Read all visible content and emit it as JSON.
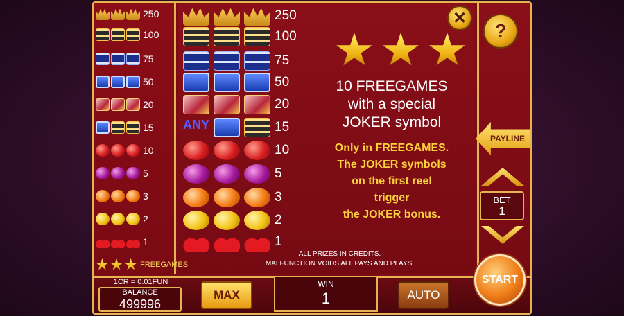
{
  "left_paytable": [
    {
      "symbol": "crown",
      "value": "250"
    },
    {
      "symbol": "bar3",
      "value": "100"
    },
    {
      "symbol": "bar2",
      "value": "75"
    },
    {
      "symbol": "bar1",
      "value": "50"
    },
    {
      "symbol": "joker",
      "value": "20"
    },
    {
      "symbol": "any-bar",
      "value": "15"
    },
    {
      "symbol": "apple",
      "value": "10"
    },
    {
      "symbol": "plum",
      "value": "5"
    },
    {
      "symbol": "orange",
      "value": "3"
    },
    {
      "symbol": "lemon",
      "value": "2"
    },
    {
      "symbol": "cherry",
      "value": "1"
    }
  ],
  "freegames_label": "FREEGAMES",
  "main_paytable": [
    {
      "symbol": "crown",
      "value": "250"
    },
    {
      "symbol": "bar3",
      "value": "100"
    },
    {
      "symbol": "bar2",
      "value": "75"
    },
    {
      "symbol": "bar1",
      "value": "50"
    },
    {
      "symbol": "joker",
      "value": "20"
    },
    {
      "symbol": "any-bar",
      "value": "15"
    },
    {
      "symbol": "apple",
      "value": "10"
    },
    {
      "symbol": "plum",
      "value": "5"
    },
    {
      "symbol": "orange",
      "value": "3"
    },
    {
      "symbol": "lemon",
      "value": "2"
    },
    {
      "symbol": "cherry",
      "value": "1"
    }
  ],
  "any_text": "ANY",
  "bar_text": "BAR",
  "info": {
    "line1": "10 FREEGAMES",
    "line2": "with a special",
    "line3": "JOKER symbol",
    "y1": "Only in FREEGAMES.",
    "y2": "The JOKER symbols",
    "y3": "on the first reel",
    "y4": "trigger",
    "y5": "the JOKER bonus."
  },
  "footer": {
    "line1": "ALL PRIZES IN CREDITS.",
    "line2": "MALFUNCTION VOIDS ALL PAYS AND PLAYS."
  },
  "controls": {
    "close": "✕",
    "help": "?",
    "payline": "PAYLINE",
    "bet_label": "BET",
    "bet_value": "1",
    "start": "START",
    "rate": "1CR = 0.01FUN",
    "balance_label": "BALANCE",
    "balance_value": "499996",
    "max": "MAX",
    "win_label": "WIN",
    "win_value": "1",
    "auto": "AUTO"
  },
  "colors": {
    "frame_gold": "#e5b451",
    "panel_red": "#7a0c15",
    "info_yellow": "#ffd23a"
  }
}
